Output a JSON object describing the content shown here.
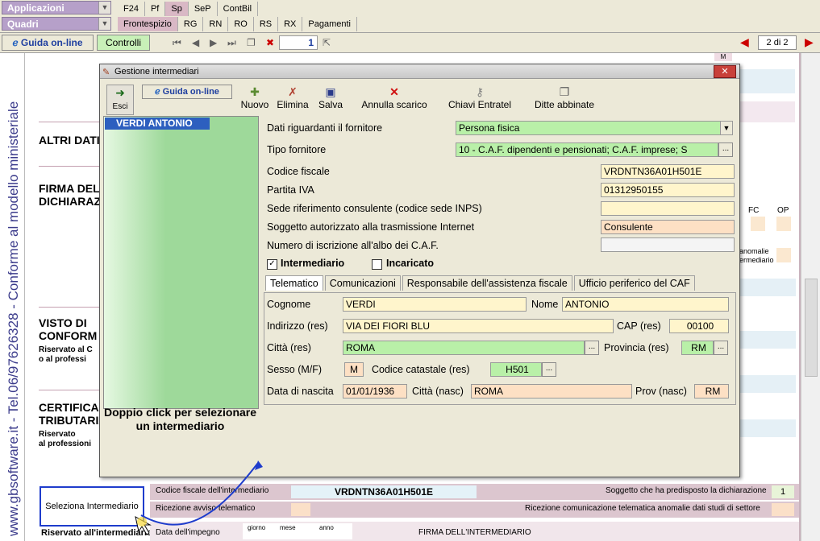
{
  "topbar": {
    "combo1": "Applicazioni",
    "combo2": "Quadri",
    "row1_tabs": [
      "F24",
      "Pf",
      "Sp",
      "SeP",
      "ContBil"
    ],
    "row1_active": 2,
    "row2_tabs": [
      "Frontespizio",
      "RG",
      "RN",
      "RO",
      "RS",
      "RX",
      "Pagamenti"
    ],
    "row2_active": 0
  },
  "toolbar": {
    "guida_label": "Guida on-line",
    "controlli_label": "Controlli",
    "page_input": "1",
    "page_count": "2 di 2"
  },
  "brand": {
    "text": "www.gbsoftware.it - Tel.06/97626328 - Conforme al modello ministeriale"
  },
  "form": {
    "sections": {
      "altri_dati": "ALTRI DATI",
      "firma_1": "FIRMA DEL",
      "firma_2": "DICHIARAZ",
      "visto_1": "VISTO DI",
      "visto_2": "CONFORM",
      "visto_sub1": "Riservato al C",
      "visto_sub2": "o al professi",
      "cert_1": "CERTIFICAZ",
      "cert_2": "TRIBUTARIA",
      "cert_sub1": "Riservato",
      "cert_sub2": "al professioni"
    },
    "fc_label": "FC",
    "op_label": "OP",
    "anomalie_1": "anomalie",
    "anomalie_2": "ermediario",
    "m_label": "M",
    "seleziona_btn": "Seleziona Intermediario",
    "riservato_label": "Riservato all'intermediario",
    "cf_intermediario_label": "Codice fiscale dell'intermediario",
    "cf_intermediario_value": "VRDNTN36A01H501E",
    "soggetto_predisposto_label": "Soggetto che ha predisposto la dichiarazione",
    "soggetto_predisposto_value": "1",
    "ricezione_avviso_label": "Ricezione avviso telematico",
    "ricezione_anomalie_label": "Ricezione comunicazione telematica anomalie dati studi di settore",
    "data_impegno_label": "Data dell'impegno",
    "giorno": "giorno",
    "mese": "mese",
    "anno": "anno",
    "firma_intermediario_label": "FIRMA DELL'INTERMEDIARIO"
  },
  "dialog": {
    "title": "Gestione intermediari",
    "toolbar": {
      "esci": "Esci",
      "guida": "Guida on-line",
      "nuovo": "Nuovo",
      "elimina": "Elimina",
      "salva": "Salva",
      "annulla": "Annulla scarico",
      "chiavi": "Chiavi Entratel",
      "ditte": "Ditte abbinate"
    },
    "list_items": [
      "VERDI ANTONIO"
    ],
    "list_caption": "Doppio click per selezionare un intermediario",
    "fields": {
      "dati_fornitore_label": "Dati riguardanti il fornitore",
      "dati_fornitore_value": "Persona fisica",
      "tipo_fornitore_label": "Tipo fornitore",
      "tipo_fornitore_value": "10 - C.A.F. dipendenti e pensionati; C.A.F. imprese; S",
      "codice_fiscale_label": "Codice fiscale",
      "codice_fiscale_value": "VRDNTN36A01H501E",
      "partita_iva_label": "Partita IVA",
      "partita_iva_value": "01312950155",
      "sede_label": "Sede riferimento consulente (codice sede INPS)",
      "sede_value": "",
      "soggetto_label": "Soggetto autorizzato alla trasmissione Internet",
      "soggetto_value": "Consulente",
      "albo_label": "Numero di iscrizione all'albo dei C.A.F.",
      "albo_value": ""
    },
    "checks": {
      "intermediario_label": "Intermediario",
      "intermediario_checked": true,
      "incaricato_label": "Incaricato",
      "incaricato_checked": false
    },
    "tabs": [
      "Telematico",
      "Comunicazioni",
      "Responsabile dell'assistenza fiscale",
      "Ufficio periferico del CAF"
    ],
    "active_tab": 0,
    "telematico": {
      "cognome_label": "Cognome",
      "cognome_value": "VERDI",
      "nome_label": "Nome",
      "nome_value": "ANTONIO",
      "indirizzo_label": "Indirizzo (res)",
      "indirizzo_value": "VIA DEI FIORI BLU",
      "cap_label": "CAP (res)",
      "cap_value": "00100",
      "citta_label": "Città (res)",
      "citta_value": "ROMA",
      "provincia_label": "Provincia (res)",
      "provincia_value": "RM",
      "sesso_label": "Sesso (M/F)",
      "sesso_value": "M",
      "catastale_label": "Codice catastale (res)",
      "catastale_value": "H501",
      "nascita_label": "Data di nascita",
      "nascita_value": "01/01/1936",
      "citta_nasc_label": "Città (nasc)",
      "citta_nasc_value": "ROMA",
      "prov_nasc_label": "Prov (nasc)",
      "prov_nasc_value": "RM"
    }
  }
}
